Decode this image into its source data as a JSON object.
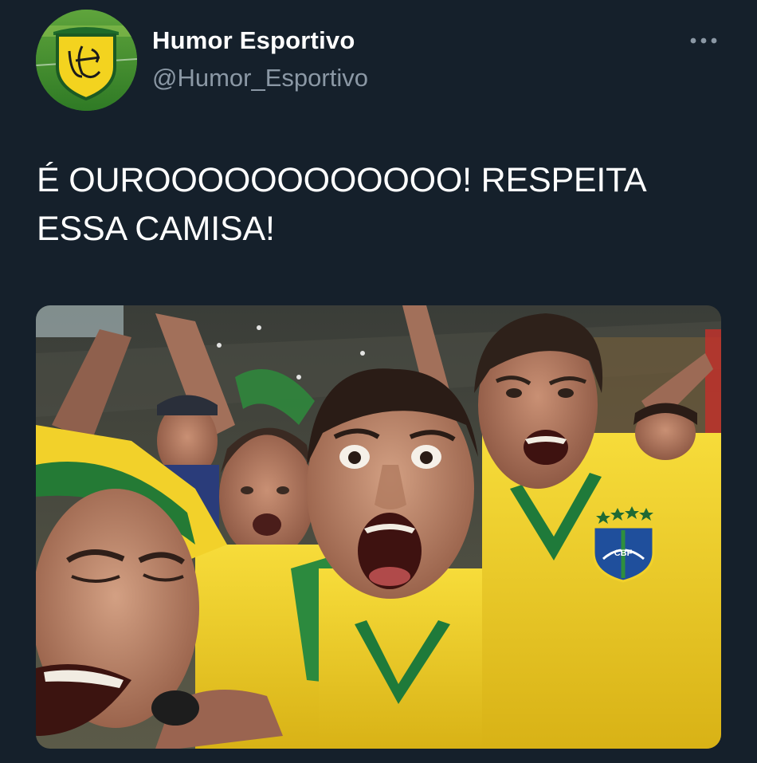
{
  "tweet": {
    "author": {
      "display_name": "Humor Esportivo",
      "handle": "@Humor_Esportivo",
      "avatar_monogram": "HE"
    },
    "menu_icon": "more-horizontal-icon",
    "text": "É OUROOOOOOOOOOOO! RESPEITA ESSA CAMISA!",
    "media": {
      "kind": "photo",
      "badge_text": "CBF"
    }
  },
  "colors": {
    "background": "#15202b",
    "primary_text": "#ffffff",
    "secondary_text": "#8b98a5",
    "jersey_yellow": "#f2cf2a",
    "jersey_green": "#1f7a3a"
  }
}
